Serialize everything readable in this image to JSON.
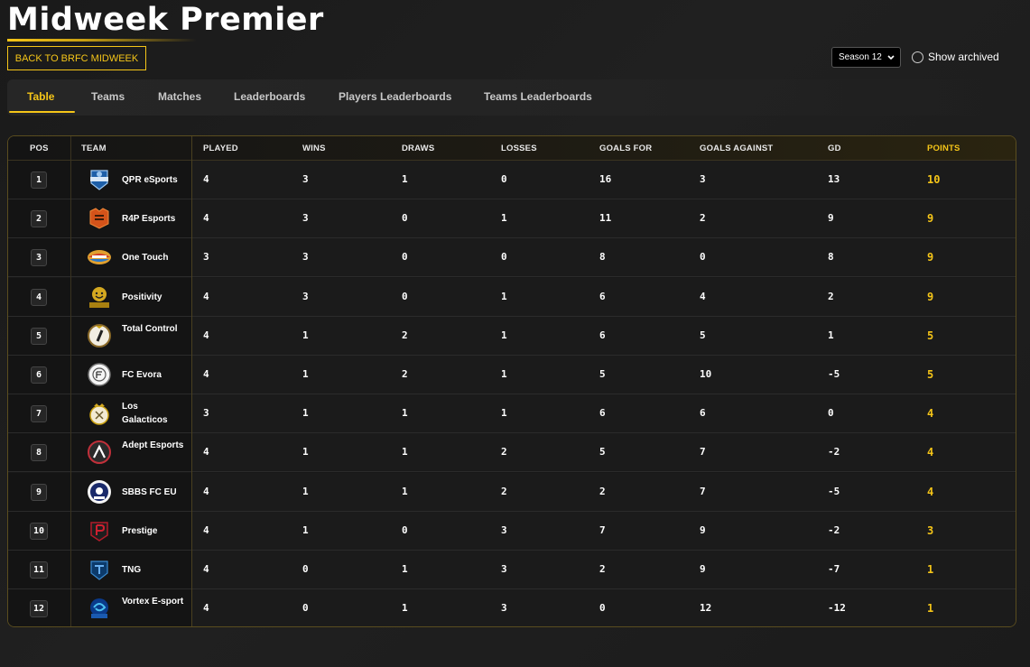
{
  "page": {
    "title": "Midweek Premier",
    "back_label": "BACK TO BRFC MIDWEEK",
    "season_selected": "Season 12",
    "show_archived_label": "Show archived",
    "accent_color": "#f5c518"
  },
  "tabs": [
    {
      "label": "Table",
      "active": true
    },
    {
      "label": "Teams",
      "active": false
    },
    {
      "label": "Matches",
      "active": false
    },
    {
      "label": "Leaderboards",
      "active": false
    },
    {
      "label": "Players Leaderboards",
      "active": false
    },
    {
      "label": "Teams Leaderboards",
      "active": false
    }
  ],
  "table": {
    "headers": {
      "pos": "POS",
      "team": "TEAM",
      "played": "PLAYED",
      "wins": "WINS",
      "draws": "DRAWS",
      "losses": "LOSSES",
      "goals_for": "GOALS FOR",
      "goals_against": "GOALS AGAINST",
      "gd": "GD",
      "points": "POINTS"
    },
    "rows": [
      {
        "pos": "1",
        "team": "QPR eSports",
        "logo": "qpr-logo-icon",
        "played": "4",
        "wins": "3",
        "draws": "1",
        "losses": "0",
        "gf": "16",
        "ga": "3",
        "gd": "13",
        "pts": "10"
      },
      {
        "pos": "2",
        "team": "R4P Esports",
        "logo": "r4p-logo-icon",
        "played": "4",
        "wins": "3",
        "draws": "0",
        "losses": "1",
        "gf": "11",
        "ga": "2",
        "gd": "9",
        "pts": "9"
      },
      {
        "pos": "3",
        "team": "One Touch",
        "logo": "one-touch-logo-icon",
        "played": "3",
        "wins": "3",
        "draws": "0",
        "losses": "0",
        "gf": "8",
        "ga": "0",
        "gd": "8",
        "pts": "9"
      },
      {
        "pos": "4",
        "team": "Positivity",
        "logo": "positivity-logo-icon",
        "played": "4",
        "wins": "3",
        "draws": "0",
        "losses": "1",
        "gf": "6",
        "ga": "4",
        "gd": "2",
        "pts": "9"
      },
      {
        "pos": "5",
        "team": "Total Control",
        "logo": "total-control-logo-icon",
        "played": "4",
        "wins": "1",
        "draws": "2",
        "losses": "1",
        "gf": "6",
        "ga": "5",
        "gd": "1",
        "pts": "5"
      },
      {
        "pos": "6",
        "team": "FC Evora",
        "logo": "fc-evora-logo-icon",
        "played": "4",
        "wins": "1",
        "draws": "2",
        "losses": "1",
        "gf": "5",
        "ga": "10",
        "gd": "-5",
        "pts": "5"
      },
      {
        "pos": "7",
        "team": "Los Galacticos",
        "logo": "los-galacticos-logo-icon",
        "played": "3",
        "wins": "1",
        "draws": "1",
        "losses": "1",
        "gf": "6",
        "ga": "6",
        "gd": "0",
        "pts": "4"
      },
      {
        "pos": "8",
        "team": "Adept Esports",
        "logo": "adept-logo-icon",
        "played": "4",
        "wins": "1",
        "draws": "1",
        "losses": "2",
        "gf": "5",
        "ga": "7",
        "gd": "-2",
        "pts": "4"
      },
      {
        "pos": "9",
        "team": "SBBS FC EU",
        "logo": "sbbs-logo-icon",
        "played": "4",
        "wins": "1",
        "draws": "1",
        "losses": "2",
        "gf": "2",
        "ga": "7",
        "gd": "-5",
        "pts": "4"
      },
      {
        "pos": "10",
        "team": "Prestige",
        "logo": "prestige-logo-icon",
        "played": "4",
        "wins": "1",
        "draws": "0",
        "losses": "3",
        "gf": "7",
        "ga": "9",
        "gd": "-2",
        "pts": "3"
      },
      {
        "pos": "11",
        "team": "TNG",
        "logo": "tng-logo-icon",
        "played": "4",
        "wins": "0",
        "draws": "1",
        "losses": "3",
        "gf": "2",
        "ga": "9",
        "gd": "-7",
        "pts": "1"
      },
      {
        "pos": "12",
        "team": "Vortex E-sport",
        "logo": "vortex-logo-icon",
        "played": "4",
        "wins": "0",
        "draws": "1",
        "losses": "3",
        "gf": "0",
        "ga": "12",
        "gd": "-12",
        "pts": "1"
      }
    ]
  }
}
